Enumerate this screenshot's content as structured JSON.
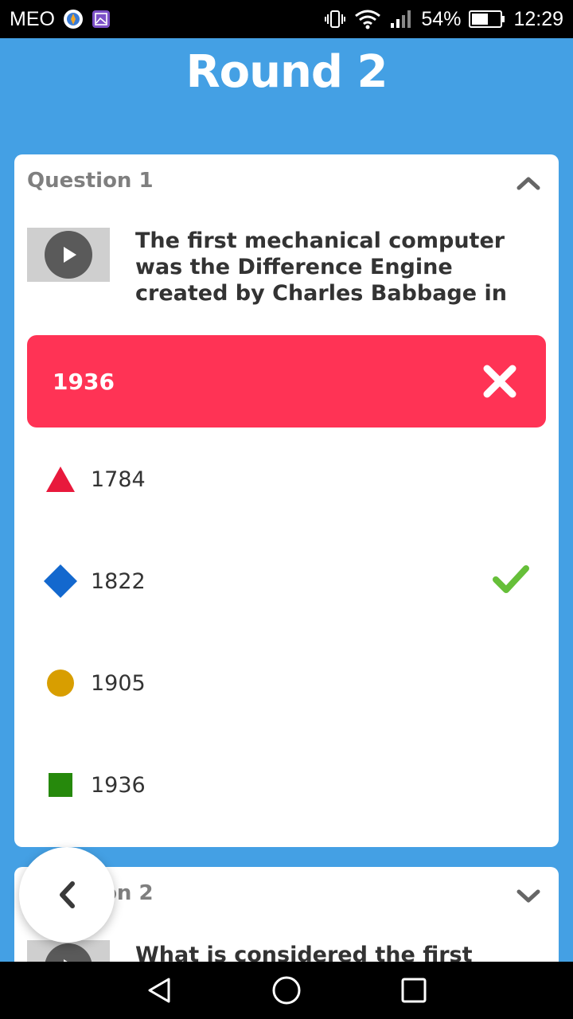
{
  "status_bar": {
    "carrier": "MEO",
    "battery": "54%",
    "time": "12:29",
    "icons": [
      "nos-app-icon",
      "gallery-app-icon",
      "vibrate-icon",
      "wifi-icon",
      "signal-icon",
      "battery-icon"
    ]
  },
  "header": {
    "title": "Round 2"
  },
  "question1": {
    "label": "Question 1",
    "text": "The first mechanical computer was the Difference Engine created by Charles Babbage in",
    "selected_answer": "1936",
    "selected_status": "incorrect",
    "answers": [
      {
        "label": "1784",
        "shape": "triangle",
        "color": "#e8193c",
        "correct": false
      },
      {
        "label": "1822",
        "shape": "diamond",
        "color": "#1368ce",
        "correct": true
      },
      {
        "label": "1905",
        "shape": "circle",
        "color": "#d89e00",
        "correct": false
      },
      {
        "label": "1936",
        "shape": "square",
        "color": "#26890c",
        "correct": false
      }
    ]
  },
  "question2": {
    "label": "Question 2",
    "text": "What is considered the first digital"
  },
  "colors": {
    "background": "#44a0e4",
    "selected_wrong": "#ff3355",
    "check": "#66bf39"
  }
}
